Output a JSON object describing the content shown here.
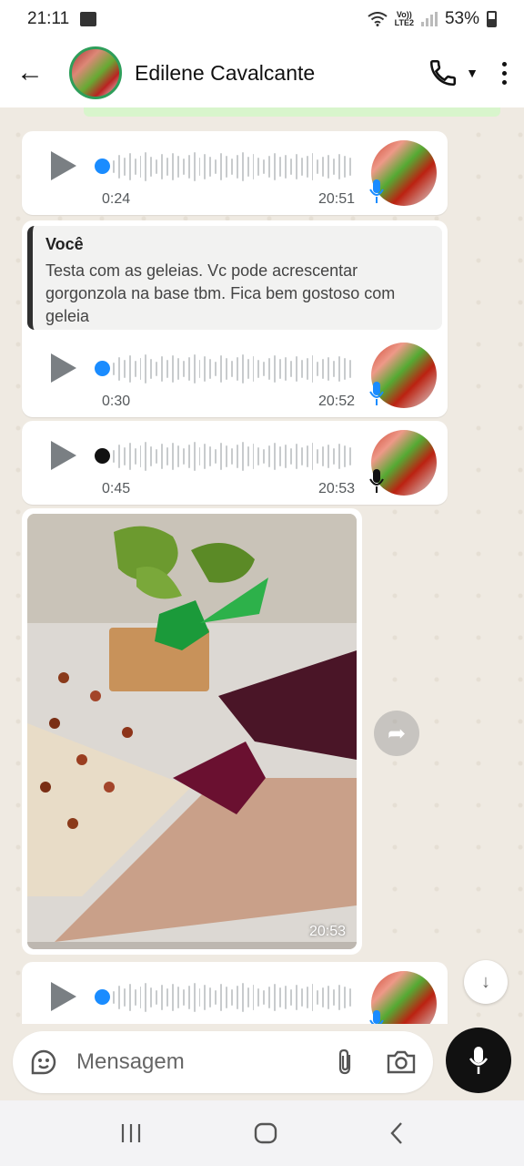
{
  "status_bar": {
    "time": "21:11",
    "network": "LTE2",
    "volte": "Vo))",
    "battery": "53%"
  },
  "header": {
    "contact_name": "Edilene Cavalcante"
  },
  "messages": {
    "voice1": {
      "duration": "0:24",
      "time": "20:51"
    },
    "reply": {
      "quoted_author": "Você",
      "quoted_text": "Testa com as geleias. Vc pode acrescentar gorgonzola na base tbm. Fica bem gostoso com geleia",
      "duration": "0:30",
      "time": "20:52"
    },
    "voice3": {
      "duration": "0:45",
      "time": "20:53"
    },
    "photo": {
      "time": "20:53"
    }
  },
  "composer": {
    "placeholder": "Mensagem"
  },
  "colors": {
    "accent_green": "#2e9e5a",
    "played_dot": "#1a8cff",
    "bubble": "#ffffff",
    "chat_bg": "#efeae2"
  },
  "icons": [
    "back-arrow-icon",
    "phone-icon",
    "more-icon",
    "play-icon",
    "mic-icon",
    "forward-icon",
    "chevrons-down-icon",
    "sticker-icon",
    "paperclip-icon",
    "camera-icon",
    "recents-icon",
    "home-icon",
    "nav-back-icon"
  ]
}
